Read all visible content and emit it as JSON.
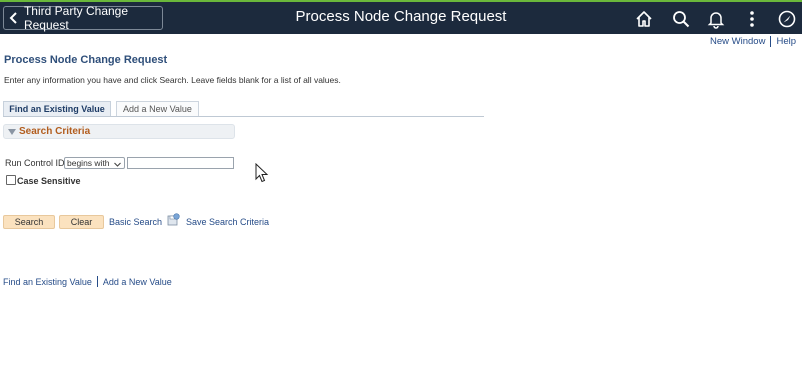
{
  "header": {
    "back_label": "Third Party Change Request",
    "title": "Process Node Change Request",
    "icons": [
      "home-icon",
      "search-icon",
      "bell-icon",
      "more-icon",
      "navbar-icon"
    ]
  },
  "toplinks": {
    "new_window": "New Window",
    "help": "Help"
  },
  "page": {
    "title": "Process Node Change Request",
    "instructions": "Enter any information you have and click Search. Leave fields blank for a list of all values."
  },
  "tabs": {
    "find": "Find an Existing Value",
    "add": "Add a New Value"
  },
  "search_criteria": {
    "header": "Search Criteria",
    "run_control_label": "Run Control ID",
    "operator_value": "begins with",
    "run_control_value": "",
    "case_sensitive_label": "Case Sensitive",
    "case_sensitive_checked": false
  },
  "actions": {
    "search": "Search",
    "clear": "Clear",
    "basic_search": "Basic Search",
    "save_search_criteria": "Save Search Criteria"
  },
  "bottom_links": {
    "find": "Find an Existing Value",
    "add": "Add a New Value"
  },
  "colors": {
    "header_bg": "#1c2a3d",
    "header_accent": "#6ab83b",
    "link": "#264c88",
    "button_bg": "#fbe2bf",
    "criteria_label": "#b25d1e"
  }
}
